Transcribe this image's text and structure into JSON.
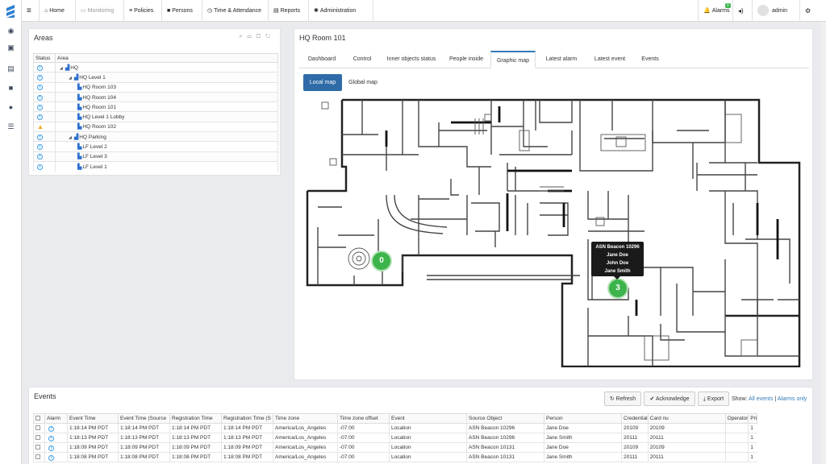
{
  "nav": {
    "items": [
      {
        "icon": "dashboard-icon",
        "glyph": "◉"
      },
      {
        "icon": "floorplan-icon",
        "glyph": "▣"
      },
      {
        "icon": "map-icon",
        "glyph": "▤"
      },
      {
        "icon": "video-icon",
        "glyph": "■"
      },
      {
        "icon": "location-pin-icon",
        "glyph": "●"
      },
      {
        "icon": "list-icon",
        "glyph": "☰"
      }
    ]
  },
  "topbar": {
    "menu": [
      {
        "name": "home",
        "label": "Home",
        "glyph": "⌂",
        "dim": false
      },
      {
        "name": "monitoring",
        "label": "Monitoring",
        "glyph": "▭",
        "dim": true
      },
      {
        "name": "policies",
        "label": "Policies",
        "glyph": "≡",
        "dim": false
      },
      {
        "name": "persons",
        "label": "Persons",
        "glyph": "■",
        "dim": false
      },
      {
        "name": "time-attendance",
        "label": "Time & Attendance",
        "glyph": "◷",
        "dim": false
      },
      {
        "name": "reports",
        "label": "Reports",
        "glyph": "▤",
        "dim": false
      },
      {
        "name": "administration",
        "label": "Administration",
        "glyph": "✱",
        "dim": false
      }
    ],
    "alarms_label": "Alarms",
    "alarms_count": "0",
    "user": "admin"
  },
  "areas": {
    "title": "Areas",
    "col_status": "Status",
    "col_area": "Area",
    "rows": [
      {
        "status": "info",
        "level": 0,
        "expand": true,
        "label": "HQ"
      },
      {
        "status": "info",
        "level": 1,
        "expand": true,
        "label": "HQ Level 1"
      },
      {
        "status": "info",
        "level": 2,
        "expand": false,
        "label": "HQ Room 103"
      },
      {
        "status": "info",
        "level": 2,
        "expand": false,
        "label": "HQ Room 104"
      },
      {
        "status": "info",
        "level": 2,
        "expand": false,
        "label": "HQ Room 101"
      },
      {
        "status": "info",
        "level": 2,
        "expand": false,
        "label": "HQ Level 1 Lobby"
      },
      {
        "status": "warning",
        "level": 2,
        "expand": false,
        "label": "HQ Room 102"
      },
      {
        "status": "info",
        "level": 1,
        "expand": true,
        "label": "HQ Parking"
      },
      {
        "status": "info",
        "level": 2,
        "expand": false,
        "label": "LF Level 2"
      },
      {
        "status": "info",
        "level": 2,
        "expand": false,
        "label": "LF Level 3"
      },
      {
        "status": "info",
        "level": 2,
        "expand": false,
        "label": "LF Level 1"
      }
    ]
  },
  "room": {
    "title": "HQ Room 101",
    "tabs": [
      "Dashboard",
      "Control",
      "Inner objects status",
      "People inside",
      "Graphic map",
      "Latest alarm",
      "Latest event",
      "Events"
    ],
    "active_tab": "Graphic map",
    "map_buttons": {
      "local": "Local map",
      "global": "Global map"
    },
    "markers": [
      {
        "count": "0"
      },
      {
        "count": "3"
      }
    ],
    "tooltip": {
      "title": "ASN Beacon 10296",
      "people": [
        "Jane Doe",
        "John Doe",
        "Jane Smith"
      ]
    }
  },
  "events": {
    "title": "Events",
    "refresh": "Refresh",
    "acknowledge": "Acknowledge",
    "export": "Export",
    "show_label": "Show:",
    "all_events": "All events",
    "sep": "|",
    "alarms_only": "Alarms only",
    "columns": [
      "Alarm",
      "Event Time",
      "Event Time (Source",
      "Registration Time",
      "Registration Time (S",
      "Time zone",
      "Time zone offset",
      "Event",
      "Source Object",
      "Person",
      "Credential",
      "Card nu",
      "Operator",
      "Pri"
    ],
    "rows": [
      [
        "1:18:14 PM PDT",
        "1:18:14 PM PDT",
        "1:18:14 PM PDT",
        "1:18:14 PM PDT",
        "America/Los_Angeles",
        "-07:00",
        "Location",
        "ASN Beacon 10296",
        "Jane Doe",
        "20109",
        "20109",
        "",
        "1"
      ],
      [
        "1:18:13 PM PDT",
        "1:18:13 PM PDT",
        "1:18:13 PM PDT",
        "1:18:13 PM PDT",
        "America/Los_Angeles",
        "-07:00",
        "Location",
        "ASN Beacon 10296",
        "Jane Smith",
        "20111",
        "20111",
        "",
        "1"
      ],
      [
        "1:18:09 PM PDT",
        "1:18:09 PM PDT",
        "1:18:09 PM PDT",
        "1:18:09 PM PDT",
        "America/Los_Angeles",
        "-07:00",
        "Location",
        "ASN Beacon 10131",
        "Jane Doe",
        "20109",
        "20109",
        "",
        "1"
      ],
      [
        "1:18:08 PM PDT",
        "1:18:08 PM PDT",
        "1:18:08 PM PDT",
        "1:18:08 PM PDT",
        "America/Los_Angeles",
        "-07:00",
        "Location",
        "ASN Beacon 10131",
        "Jane Smith",
        "20111",
        "20111",
        "",
        "1"
      ]
    ]
  }
}
